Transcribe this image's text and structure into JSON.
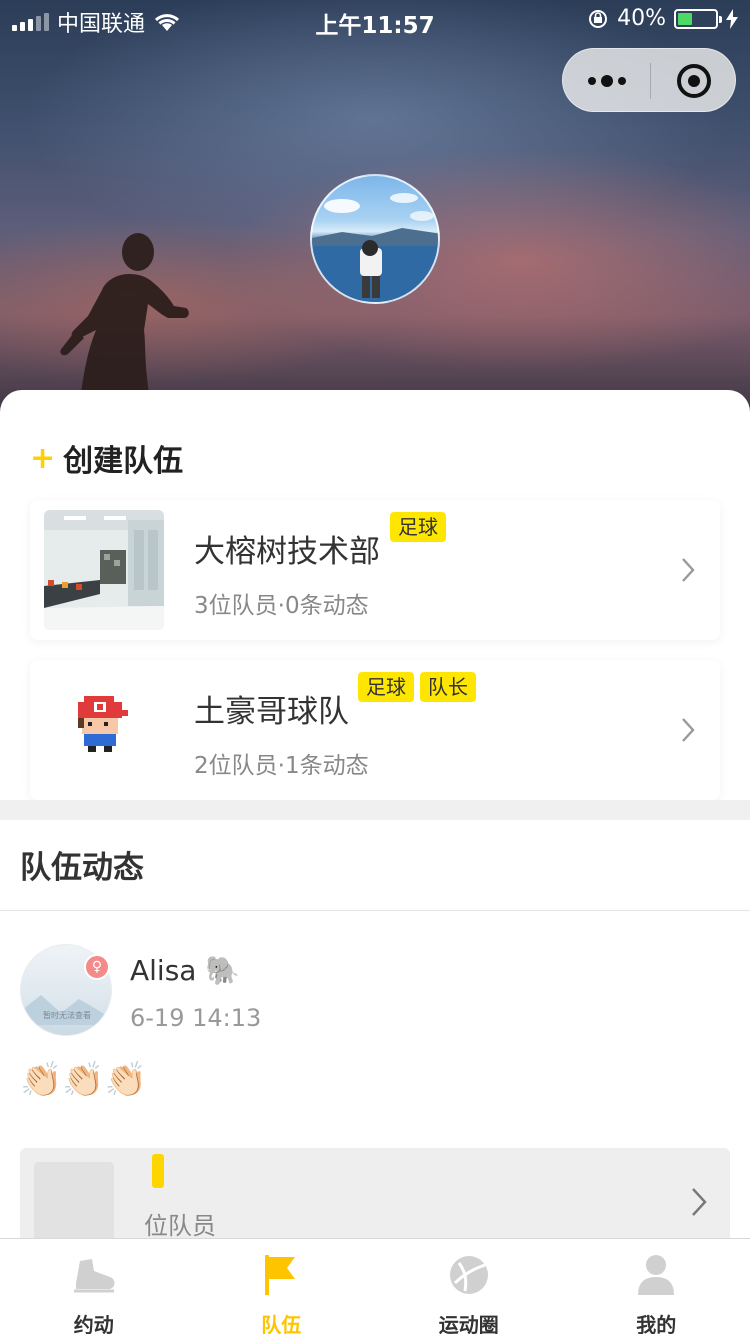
{
  "status_bar": {
    "carrier": "中国联通",
    "time": "上午11:57",
    "battery_percent": "40%",
    "battery_level": 0.4
  },
  "capsule": {
    "more_icon": "more-dots-icon",
    "close_icon": "target-close-icon"
  },
  "create_team": {
    "plus": "+",
    "label": "创建队伍"
  },
  "teams": [
    {
      "name": "大榕树技术部",
      "tags": [
        "足球"
      ],
      "meta": "3位队员·0条动态"
    },
    {
      "name": "土豪哥球队",
      "tags": [
        "足球",
        "队长"
      ],
      "meta": "2位队员·1条动态"
    }
  ],
  "feed": {
    "title": "队伍动态",
    "post": {
      "name": "Alisa 🐘",
      "time": "6-19 14:13",
      "text": "👏🏻👏🏻👏🏻",
      "avatar_caption": "暂时无法查看",
      "embed_meta": "位队员"
    }
  },
  "tabbar": [
    {
      "label": "约动",
      "icon": "shoe-icon",
      "active": false
    },
    {
      "label": "队伍",
      "icon": "flag-icon",
      "active": true
    },
    {
      "label": "运动圈",
      "icon": "ball-icon",
      "active": false
    },
    {
      "label": "我的",
      "icon": "user-icon",
      "active": false
    }
  ],
  "colors": {
    "accent": "#ffd000",
    "tag_bg": "#ffe600",
    "female_badge": "#f48a8a"
  }
}
